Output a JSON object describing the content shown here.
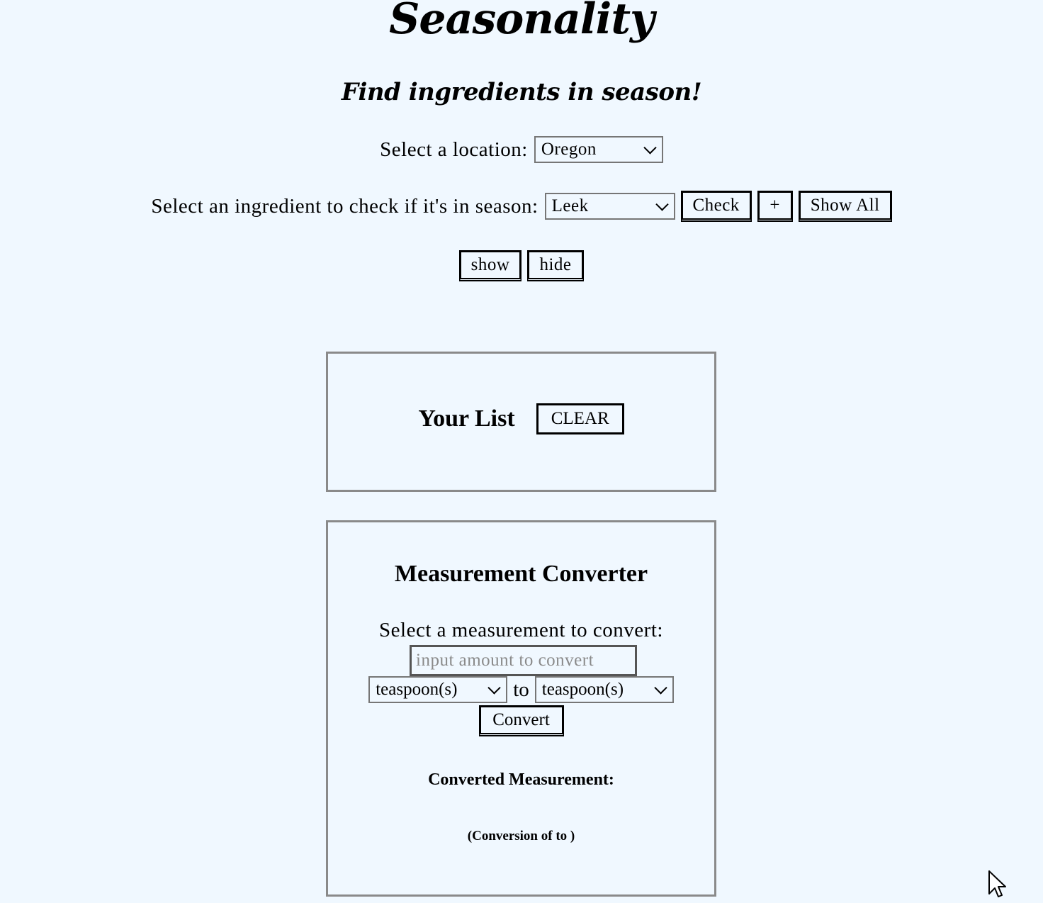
{
  "header": {
    "title": "Seasonality",
    "tagline": "Find ingredients in season!"
  },
  "location": {
    "label": "Select a location:",
    "selected": "Oregon"
  },
  "ingredient": {
    "label": "Select an ingredient to check if it's in season:",
    "selected": "Leek",
    "check_label": "Check",
    "add_label": "+",
    "show_all_label": "Show All"
  },
  "toggle": {
    "show_label": "show",
    "hide_label": "hide"
  },
  "list": {
    "title": "Your List",
    "clear_label": "CLEAR"
  },
  "converter": {
    "title": "Measurement Converter",
    "prompt": "Select a measurement to convert:",
    "amount_placeholder": "input amount to convert",
    "from_unit": "teaspoon(s)",
    "to_label": "to",
    "to_unit": "teaspoon(s)",
    "convert_label": "Convert",
    "result_label": "Converted Measurement:",
    "result_detail": "(Conversion of to )"
  }
}
